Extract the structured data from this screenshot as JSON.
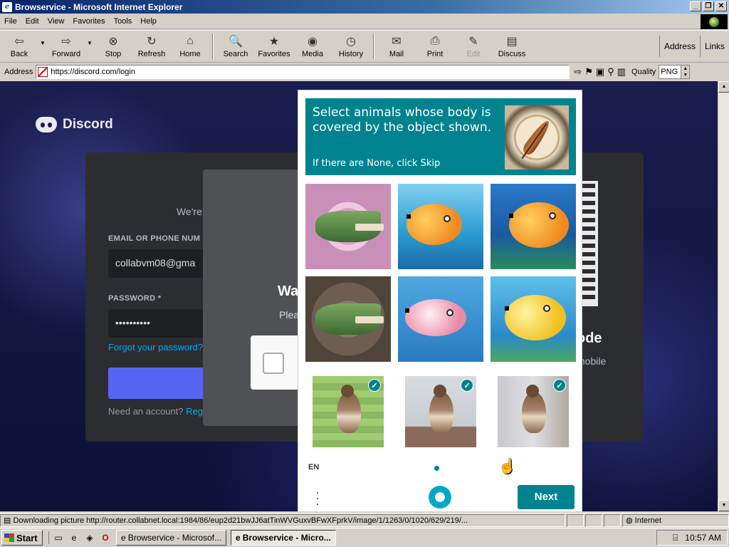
{
  "window": {
    "title": "Browservice - Microsoft Internet Explorer"
  },
  "menu": [
    "File",
    "Edit",
    "View",
    "Favorites",
    "Tools",
    "Help"
  ],
  "toolbar": {
    "back": "Back",
    "forward": "Forward",
    "stop": "Stop",
    "refresh": "Refresh",
    "home": "Home",
    "search": "Search",
    "favorites": "Favorites",
    "media": "Media",
    "history": "History",
    "mail": "Mail",
    "print": "Print",
    "edit": "Edit",
    "discuss": "Discuss",
    "address": "Address",
    "links": "Links"
  },
  "addressbar": {
    "label": "Address",
    "url": "https://discord.com/login",
    "quality_label": "Quality",
    "quality_value": "PNG"
  },
  "discord": {
    "brand": "Discord",
    "welcome_partial": "We're",
    "email_label": "EMAIL OR PHONE NUM",
    "email_value": "collabvm08@gma",
    "password_label": "PASSWORD *",
    "password_value": "••••••••••",
    "forgot": "Forgot your password?",
    "need_account": "Need an account?",
    "register": "Reg",
    "qr_title": "ode",
    "qr_text": "mobile",
    "wait_title": "Wa",
    "wait_text": "Plea"
  },
  "captcha": {
    "question": "Select animals whose body is covered by the object shown.",
    "skip_hint": "If there are None, click Skip",
    "lang": "EN",
    "next": "Next",
    "brand_color": "#00838f"
  },
  "status": {
    "text": "Downloading picture http://router.collabnet.local:1984/86/eup2d21bwJJ6atTinWVGuxvBFwXFprkV/image/1/1263/0/1020/629/219/...",
    "zone": "Internet"
  },
  "taskbar": {
    "start": "Start",
    "task1": "Browservice - Microsof...",
    "task2": "Browservice - Micro...",
    "clock": "10:57 AM"
  }
}
